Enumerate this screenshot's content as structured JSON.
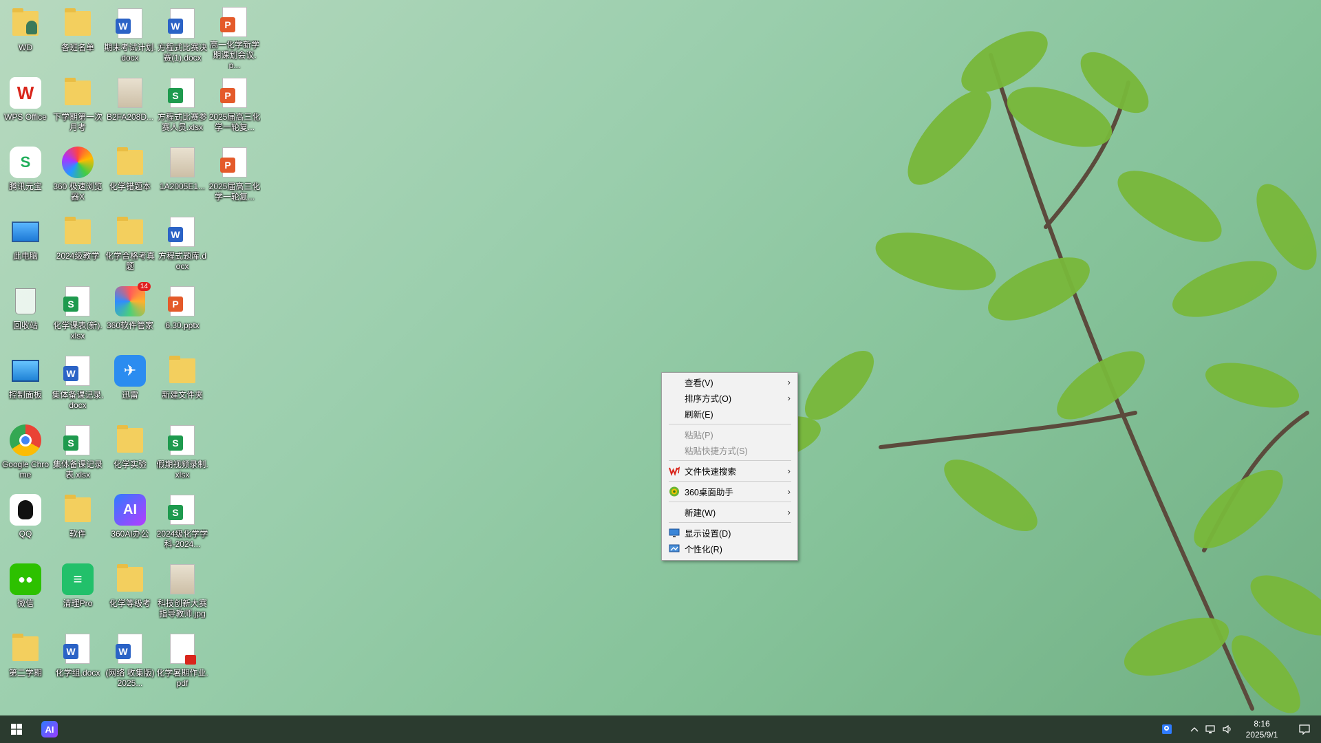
{
  "desktop": {
    "icons": [
      {
        "label": "WD",
        "kind": "user-folder-icon"
      },
      {
        "label": "各班名单",
        "kind": "folder-icon"
      },
      {
        "label": "期末考试计划.docx",
        "kind": "word-doc-icon"
      },
      {
        "label": "方程式比赛决赛(1).docx",
        "kind": "word-doc-icon"
      },
      {
        "label": "高一化学新学期课划会议.p...",
        "kind": "ppt-icon"
      },
      {
        "label": "WPS Office",
        "kind": "wps-icon"
      },
      {
        "label": "下学期第一次月考",
        "kind": "folder-icon"
      },
      {
        "label": "B2FA208D...",
        "kind": "image-icon"
      },
      {
        "label": "方程式比赛参赛人员.xlsx",
        "kind": "excel-icon"
      },
      {
        "label": "2025届高三化学一轮复...",
        "kind": "ppt-icon"
      },
      {
        "label": "腾讯元宝",
        "kind": "yuanbao-icon"
      },
      {
        "label": "360 极速浏览器X",
        "kind": "browser-360-icon"
      },
      {
        "label": "化学错题本",
        "kind": "folder-icon"
      },
      {
        "label": "1A2005E1...",
        "kind": "image-icon"
      },
      {
        "label": "2025届高三化学一轮复...",
        "kind": "ppt-icon"
      },
      {
        "label": "此电脑",
        "kind": "computer-icon"
      },
      {
        "label": "2024级教学",
        "kind": "folder-icon"
      },
      {
        "label": "化学合格考真题",
        "kind": "folder-icon"
      },
      {
        "label": "方程式题库.docx",
        "kind": "word-doc-icon"
      },
      {
        "label": "",
        "kind": "empty"
      },
      {
        "label": "回收站",
        "kind": "recycle-bin-icon"
      },
      {
        "label": "化学课表(新).xlsx",
        "kind": "excel-icon"
      },
      {
        "label": "360软件管家",
        "kind": "software-manager-icon"
      },
      {
        "label": "6.30.pptx",
        "kind": "ppt-icon"
      },
      {
        "label": "",
        "kind": "empty"
      },
      {
        "label": "控制面板",
        "kind": "control-panel-icon"
      },
      {
        "label": "集体备课记录.docx",
        "kind": "word-doc-icon"
      },
      {
        "label": "迅雷",
        "kind": "thunder-icon"
      },
      {
        "label": "新建文件夹",
        "kind": "folder-icon"
      },
      {
        "label": "",
        "kind": "empty"
      },
      {
        "label": "Google Chrome",
        "kind": "chrome-icon"
      },
      {
        "label": "集体备课记录表.xlsx",
        "kind": "excel-icon"
      },
      {
        "label": "化学实验",
        "kind": "folder-icon"
      },
      {
        "label": "假期视频录制.xlsx",
        "kind": "excel-icon"
      },
      {
        "label": "",
        "kind": "empty"
      },
      {
        "label": "QQ",
        "kind": "qq-icon"
      },
      {
        "label": "软件",
        "kind": "folder-icon"
      },
      {
        "label": "360AI办公",
        "kind": "ai-office-icon"
      },
      {
        "label": "2024级化学学科-2024...",
        "kind": "excel-icon"
      },
      {
        "label": "",
        "kind": "empty"
      },
      {
        "label": "微信",
        "kind": "wechat-icon"
      },
      {
        "label": "清理Pro",
        "kind": "cleaner-icon"
      },
      {
        "label": "化学等级考",
        "kind": "folder-icon"
      },
      {
        "label": "科技创新大赛指导教师.jpg",
        "kind": "image-icon"
      },
      {
        "label": "",
        "kind": "empty"
      },
      {
        "label": "第二学期",
        "kind": "folder-icon"
      },
      {
        "label": "化学组.docx",
        "kind": "word-doc-icon"
      },
      {
        "label": "(网络 收集版) 2025...",
        "kind": "word-doc-icon"
      },
      {
        "label": "化学暑期作业.pdf",
        "kind": "pdf-icon"
      },
      {
        "label": "",
        "kind": "empty"
      }
    ],
    "software_manager_badge": "14"
  },
  "context_menu": {
    "view": "查看(V)",
    "sort": "排序方式(O)",
    "refresh": "刷新(E)",
    "paste": "粘贴(P)",
    "paste_shortcut": "粘贴快捷方式(S)",
    "file_search": "文件快速搜索",
    "assistant_360": "360桌面助手",
    "new": "新建(W)",
    "display_settings": "显示设置(D)",
    "personalize": "个性化(R)"
  },
  "taskbar": {
    "time": "8:16",
    "date": "2025/9/1"
  },
  "colors": {
    "word": "#2b63c6",
    "excel": "#1e9a4e",
    "ppt": "#e45a2a",
    "folder": "#f3cf5e",
    "taskbar": "#2b3b2f"
  }
}
